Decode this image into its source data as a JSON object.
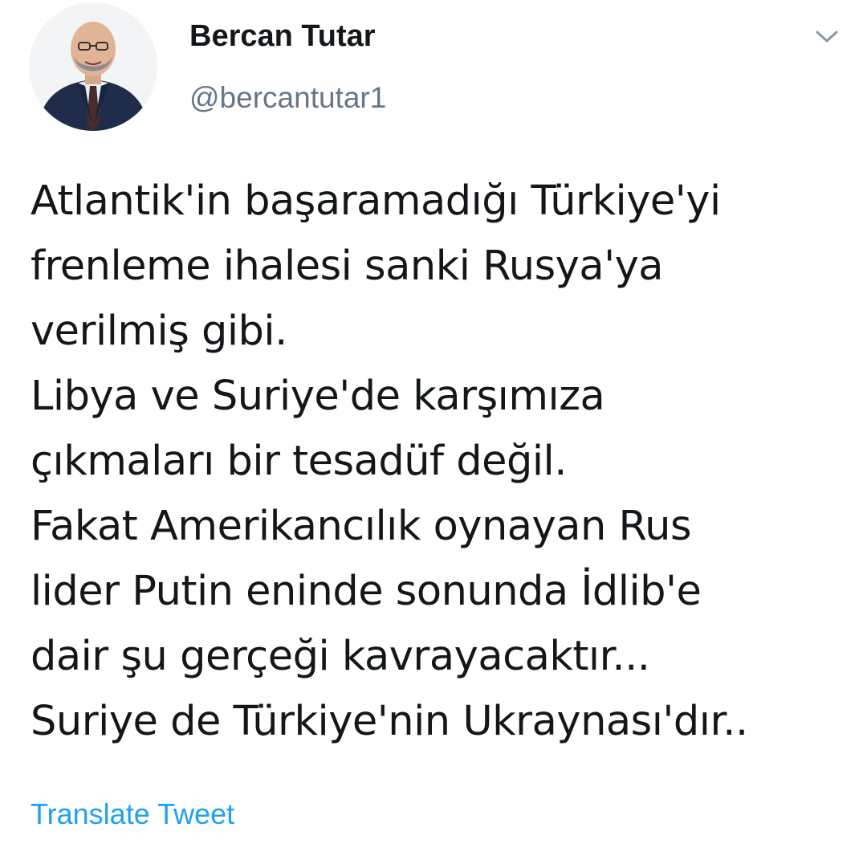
{
  "author": {
    "display_name": "Bercan Tutar",
    "handle": "@bercantutar1",
    "avatar_icon": "profile-photo"
  },
  "menu": {
    "icon": "chevron-down-icon",
    "color": "#8899a6"
  },
  "tweet": {
    "lines": [
      "Atlantik'in başaramadığı Türkiye'yi",
      "frenleme ihalesi sanki Rusya'ya",
      "verilmiş gibi.",
      "Libya ve Suriye'de karşımıza",
      "çıkmaları bir tesadüf değil.",
      "Fakat Amerikancılık oynayan Rus",
      "lider Putin eninde sonunda İdlib'e",
      "dair şu gerçeği kavrayacaktır...",
      "Suriye de Türkiye'nin Ukraynası'dır.."
    ]
  },
  "translate": {
    "label": "Translate Tweet",
    "color": "#1da1f2"
  },
  "colors": {
    "text_primary": "#14171a",
    "text_secondary": "#657786",
    "link": "#1da1f2"
  }
}
